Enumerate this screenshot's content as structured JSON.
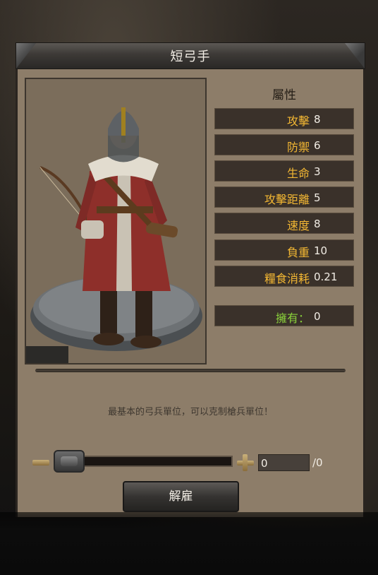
{
  "dialog": {
    "title": "短弓手",
    "attributes_heading": "屬性",
    "stats": [
      {
        "label": "攻擊",
        "value": "8"
      },
      {
        "label": "防禦",
        "value": "6"
      },
      {
        "label": "生命",
        "value": "3"
      },
      {
        "label": "攻擊距離",
        "value": "5"
      },
      {
        "label": "速度",
        "value": "8"
      },
      {
        "label": "負重",
        "value": "10"
      },
      {
        "label": "糧食消耗",
        "value": "0.21"
      }
    ],
    "owned": {
      "label": "擁有：",
      "value": "0"
    },
    "description": "最基本的弓兵單位，可以克制槍兵單位！",
    "quantity": {
      "value": "0",
      "max_label": "/0"
    },
    "dismiss_label": "解雇"
  },
  "colors": {
    "stat_label": "#f3b733",
    "owned_label": "#8ad13b",
    "panel_bg": "#8d7d69"
  }
}
